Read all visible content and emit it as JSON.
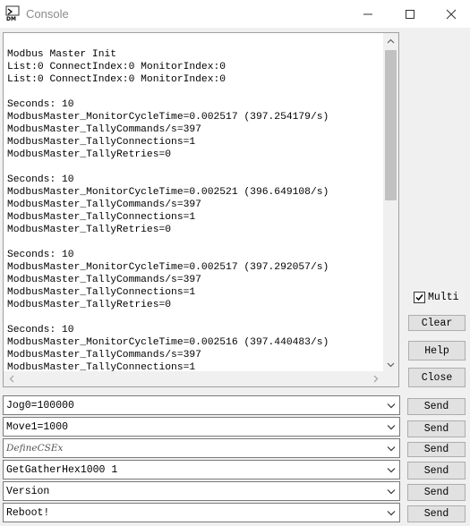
{
  "window": {
    "title": "Console",
    "icon_name": "dm-app-icon"
  },
  "output": {
    "text": "Modbus Master Init\nList:0 ConnectIndex:0 MonitorIndex:0\nList:0 ConnectIndex:0 MonitorIndex:0\n\nSeconds: 10\nModbusMaster_MonitorCycleTime=0.002517 (397.254179/s)\nModbusMaster_TallyCommands/s=397\nModbusMaster_TallyConnections=1\nModbusMaster_TallyRetries=0\n\nSeconds: 10\nModbusMaster_MonitorCycleTime=0.002521 (396.649108/s)\nModbusMaster_TallyCommands/s=397\nModbusMaster_TallyConnections=1\nModbusMaster_TallyRetries=0\n\nSeconds: 10\nModbusMaster_MonitorCycleTime=0.002517 (397.292057/s)\nModbusMaster_TallyCommands/s=397\nModbusMaster_TallyConnections=1\nModbusMaster_TallyRetries=0\n\nSeconds: 10\nModbusMaster_MonitorCycleTime=0.002516 (397.440483/s)\nModbusMaster_TallyCommands/s=397\nModbusMaster_TallyConnections=1"
  },
  "side": {
    "multi_label": "Multi",
    "multi_checked": true,
    "clear_label": "Clear",
    "help_label": "Help",
    "close_label": "Close"
  },
  "commands": [
    {
      "value": "Jog0=100000",
      "send_label": "Send"
    },
    {
      "value": "Move1=1000",
      "send_label": "Send"
    },
    {
      "value": "DefineCSEx",
      "send_label": "Send"
    },
    {
      "value": "GetGatherHex1000 1",
      "send_label": "Send"
    },
    {
      "value": "Version",
      "send_label": "Send"
    },
    {
      "value": "Reboot!",
      "send_label": "Send"
    }
  ]
}
